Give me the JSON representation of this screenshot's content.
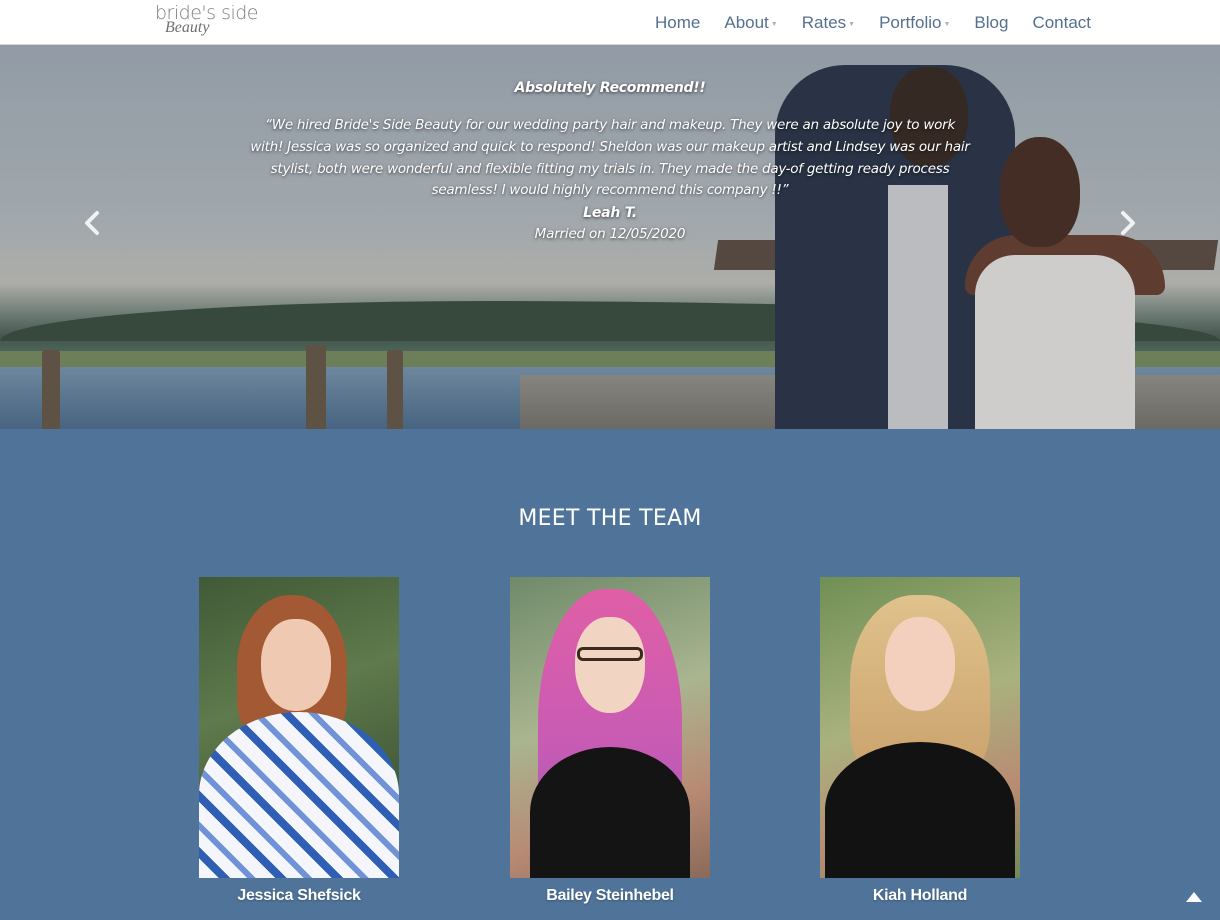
{
  "header": {
    "logo": {
      "line1": "bride's side",
      "line2": "Beauty"
    },
    "nav": [
      {
        "label": "Home",
        "dropdown": false
      },
      {
        "label": "About",
        "dropdown": true
      },
      {
        "label": "Rates",
        "dropdown": true
      },
      {
        "label": "Portfolio",
        "dropdown": true
      },
      {
        "label": "Blog",
        "dropdown": false
      },
      {
        "label": "Contact",
        "dropdown": false
      }
    ]
  },
  "hero": {
    "testimonial": {
      "title": "Absolutely Recommend!!",
      "quote_lines": [
        "“We hired Bride's Side Beauty for our wedding party hair and makeup. They were an absolute joy to work",
        "with! Jessica was so organized and quick to respond! Sheldon was our makeup artist and Lindsey was our hair",
        "stylist, both were wonderful and flexible fitting my trials in. They made the day-of getting ready process",
        "seamless! I would highly recommend this company !!”"
      ],
      "name": "Leah T.",
      "date": "Married on 12/05/2020"
    },
    "prev_icon": "chevron-left-icon",
    "next_icon": "chevron-right-icon"
  },
  "team": {
    "heading": "MEET THE TEAM",
    "members": [
      {
        "name": "Jessica Shefsick"
      },
      {
        "name": "Bailey Steinhebel"
      },
      {
        "name": "Kiah Holland"
      }
    ]
  },
  "scroll_top_icon": "caret-up-icon",
  "colors": {
    "page_background": "#4f7399",
    "nav_text": "#55708f",
    "header_background": "#ffffff"
  }
}
